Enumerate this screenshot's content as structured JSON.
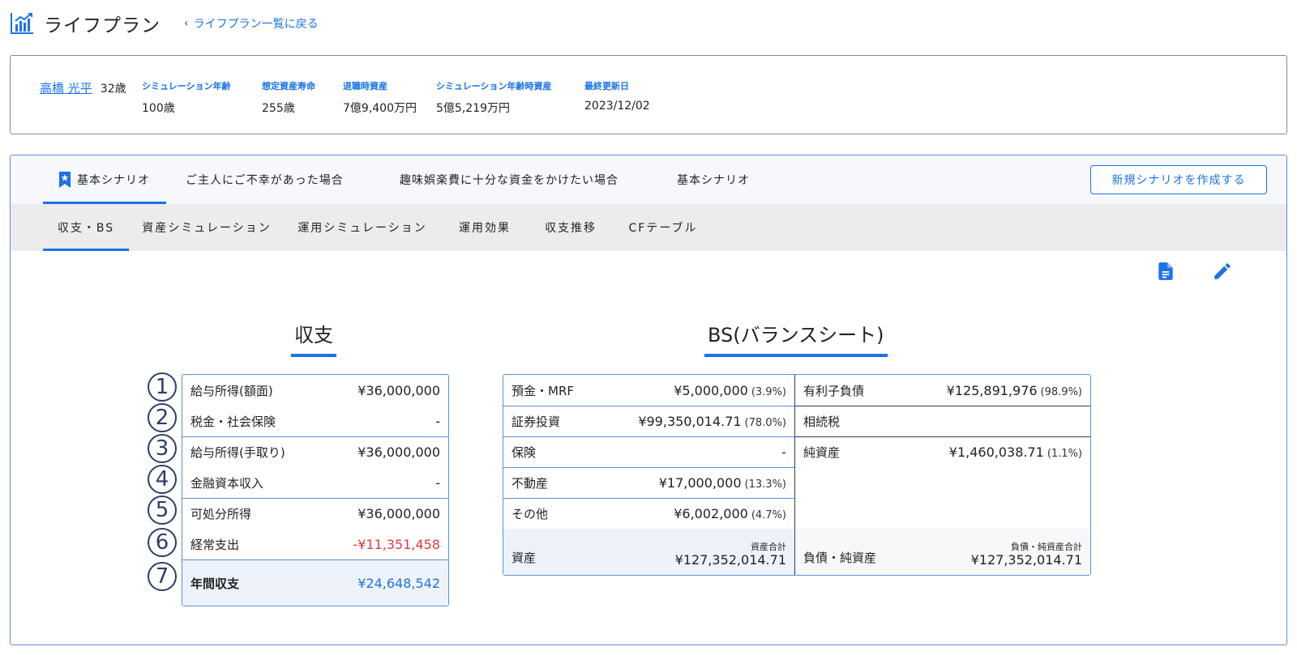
{
  "header": {
    "title": "ライフプラン",
    "back_link": "ライフプラン一覧に戻る"
  },
  "info": {
    "name": "高橋 光平",
    "age": "32歳",
    "columns": [
      {
        "label": "シミュレーション年齢",
        "value": "100歳"
      },
      {
        "label": "想定資産寿命",
        "value": "255歳"
      },
      {
        "label": "退職時資産",
        "value": "7億9,400万円"
      },
      {
        "label": "シミュレーション年齢時資産",
        "value": "5億5,219万円"
      },
      {
        "label": "最終更新日",
        "value": "2023/12/02"
      }
    ]
  },
  "scenario_tabs": [
    "基本シナリオ",
    "ご主人にご不幸があった場合",
    "趣味娯楽費に十分な資金をかけたい場合",
    "基本シナリオ"
  ],
  "new_scenario_button": "新規シナリオを作成する",
  "sub_tabs": [
    "収支・BS",
    "資産シミュレーション",
    "運用シミュレーション",
    "運用効果",
    "収支推移",
    "CFテーブル"
  ],
  "income": {
    "title": "収支",
    "rows": [
      {
        "num": "1",
        "label": "給与所得(額面)",
        "value": "¥36,000,000"
      },
      {
        "num": "2",
        "label": "税金・社会保険",
        "value": "-"
      },
      {
        "num": "3",
        "label": "給与所得(手取り)",
        "value": "¥36,000,000"
      },
      {
        "num": "4",
        "label": "金融資本収入",
        "value": "-"
      },
      {
        "num": "5",
        "label": "可処分所得",
        "value": "¥36,000,000"
      },
      {
        "num": "6",
        "label": "経常支出",
        "value": "-¥11,351,458"
      },
      {
        "num": "7",
        "label": "年間収支",
        "value": "¥24,648,542"
      }
    ]
  },
  "bs": {
    "title": "BS(バランスシート)",
    "assets": [
      {
        "label": "預金・MRF",
        "value": "¥5,000,000",
        "pct": "(3.9%)"
      },
      {
        "label": "証券投資",
        "value": "¥99,350,014.71",
        "pct": "(78.0%)"
      },
      {
        "label": "保険",
        "value": "-",
        "pct": ""
      },
      {
        "label": "不動産",
        "value": "¥17,000,000",
        "pct": "(13.3%)"
      },
      {
        "label": "その他",
        "value": "¥6,002,000",
        "pct": "(4.7%)"
      }
    ],
    "liabilities": [
      {
        "label": "有利子負債",
        "value": "¥125,891,976",
        "pct": "(98.9%)"
      },
      {
        "label": "相続税",
        "value": "",
        "pct": ""
      },
      {
        "label": "純資産",
        "value": "¥1,460,038.71",
        "pct": "(1.1%)"
      }
    ],
    "asset_total": {
      "label": "資産",
      "caption": "資産合計",
      "value": "¥127,352,014.71"
    },
    "liab_total": {
      "label": "負債・純資産",
      "caption": "負債・純資産合計",
      "value": "¥127,352,014.71"
    }
  },
  "colors": {
    "accent": "#1a73e8",
    "negative": "#d93b3b",
    "badge": "#2c3e6a"
  }
}
